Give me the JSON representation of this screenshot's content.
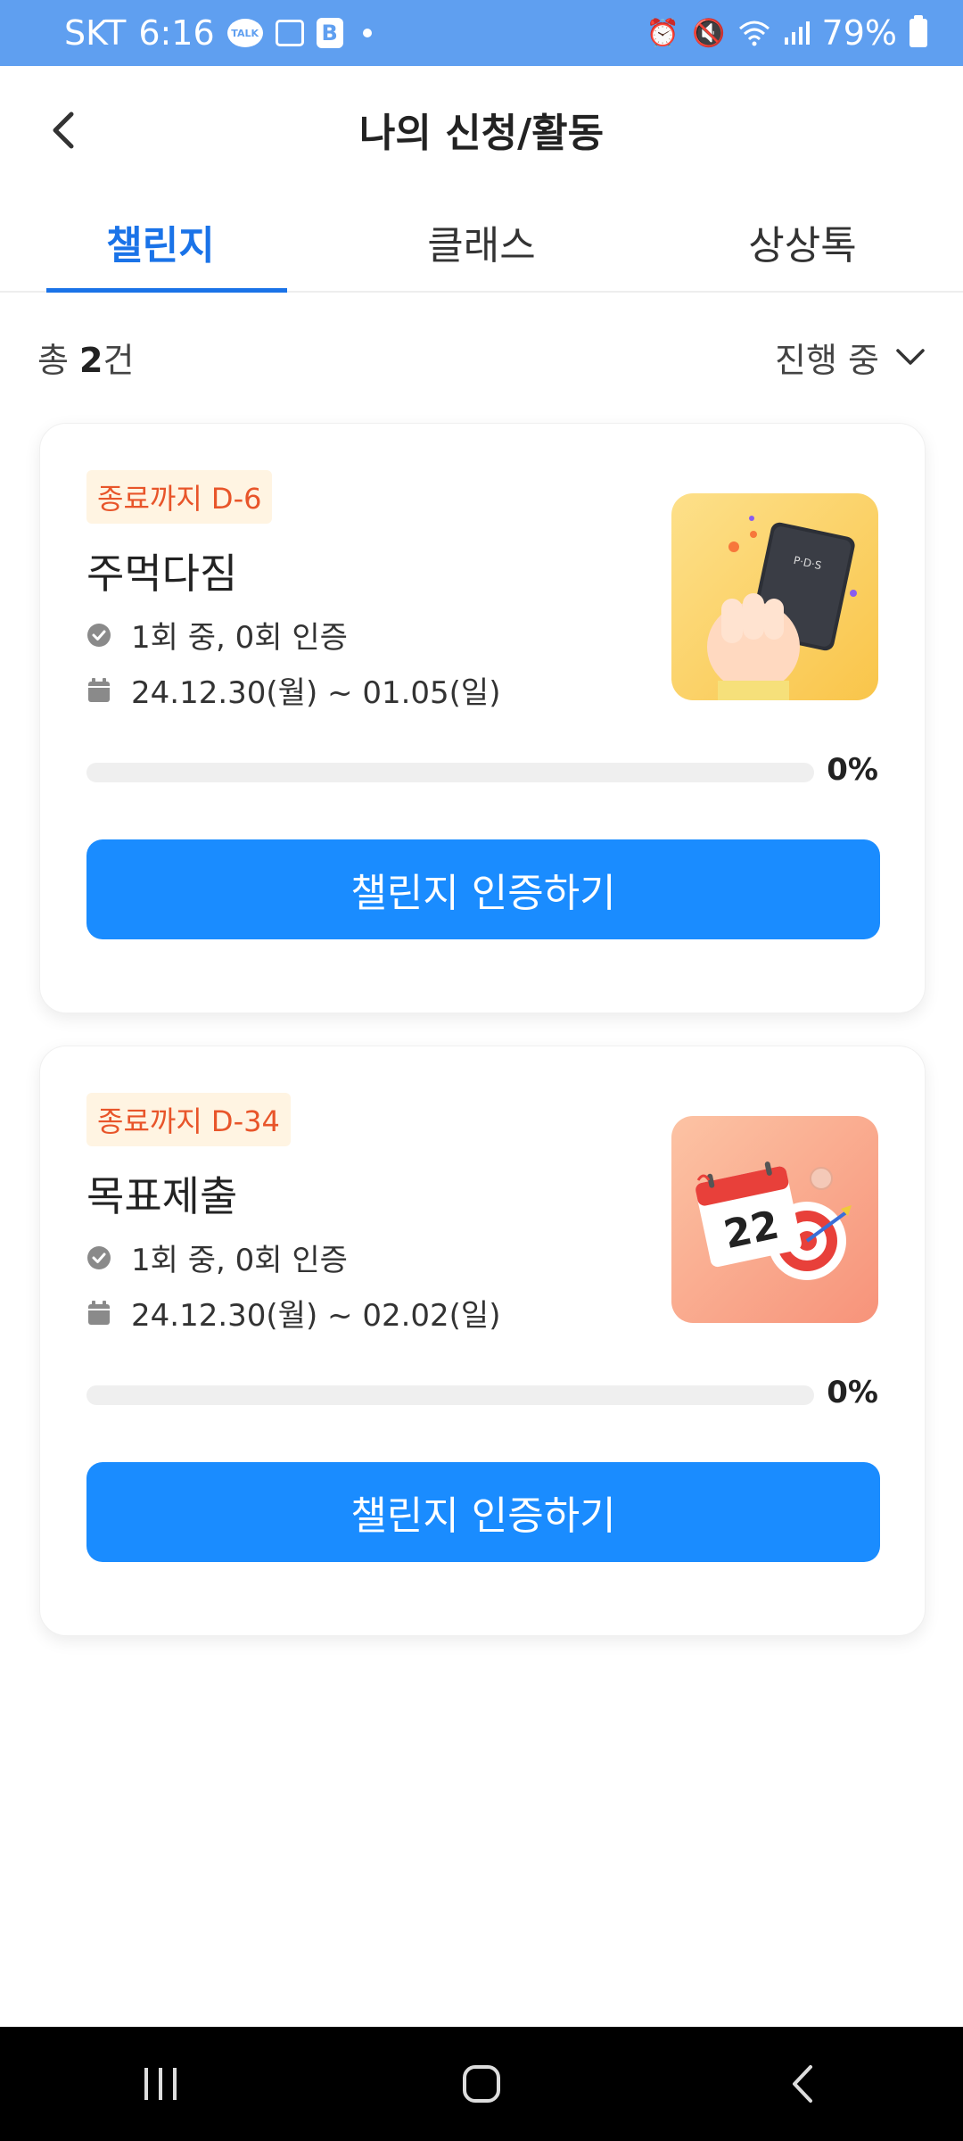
{
  "status_bar": {
    "carrier": "SKT",
    "time": "6:16",
    "talk_badge": "TALK",
    "b_badge": "B",
    "battery": "79%"
  },
  "header": {
    "title": "나의 신청/활동"
  },
  "tabs": [
    {
      "label": "챌린지",
      "active": true
    },
    {
      "label": "클래스",
      "active": false
    },
    {
      "label": "상상톡",
      "active": false
    }
  ],
  "summary": {
    "count_prefix": "총 ",
    "count": "2",
    "count_suffix": "건",
    "filter": "진행 중"
  },
  "challenges": [
    {
      "badge": "종료까지 D-6",
      "title": "주먹다짐",
      "certification": "1회 중, 0회 인증",
      "period": "24.12.30(월) ~ 01.05(일)",
      "progress": 0,
      "progress_label": "0%",
      "cta": "챌린지 인증하기",
      "thumb_book_text": "P·D·S"
    },
    {
      "badge": "종료까지 D-34",
      "title": "목표제출",
      "certification": "1회 중, 0회 인증",
      "period": "24.12.30(월) ~ 02.02(일)",
      "progress": 0,
      "progress_label": "0%",
      "cta": "챌린지 인증하기",
      "thumb_calendar_text": "22"
    }
  ],
  "colors": {
    "status_bar": "#5f9ff0",
    "accent": "#1a73e8",
    "button": "#1a8cff",
    "badge_bg": "#fff4e2",
    "badge_text": "#e8552a"
  }
}
